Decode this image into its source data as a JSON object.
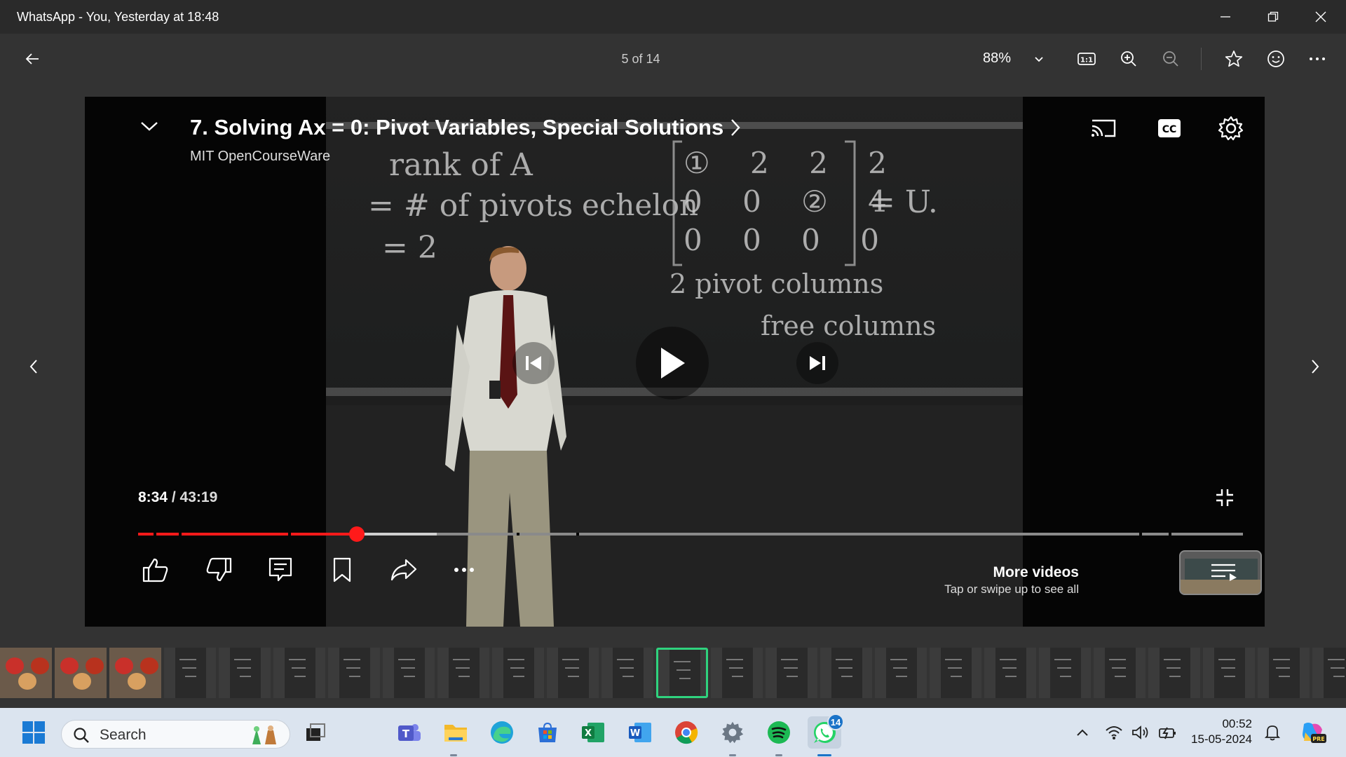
{
  "window": {
    "title": "WhatsApp - You, Yesterday at 18:48"
  },
  "toolbar": {
    "counter": "5 of 14",
    "zoom": "88%"
  },
  "video": {
    "title": "7. Solving Ax = 0: Pivot Variables, Special Solutions",
    "channel": "MIT OpenCourseWare",
    "current_time": "8:34",
    "separator": " / ",
    "duration": "43:19",
    "progress_fraction": 0.198,
    "buffered_fraction": 0.27,
    "more_videos_title": "More videos",
    "more_videos_sub": "Tap or swipe up to see all",
    "board": {
      "rank_line": "rank of A",
      "pivots_line": "= # of pivots",
      "echelon": "echelon",
      "equals_two": "= 2",
      "matrix_row1": "① 2 2 2",
      "matrix_row2": "0 0 ② 4",
      "matrix_row3": "0 0 0 0",
      "equals_u": "= U.",
      "pivot_columns": "2 pivot columns",
      "free_columns": "free columns"
    }
  },
  "taskbar": {
    "search_label": "Search",
    "whatsapp_badge": "14",
    "time": "00:52",
    "date": "15-05-2024"
  },
  "colors": {
    "progress_red": "#ff1a1a",
    "selected_thumb": "#2fd37e",
    "taskbar_bg": "#dbe4ef"
  }
}
